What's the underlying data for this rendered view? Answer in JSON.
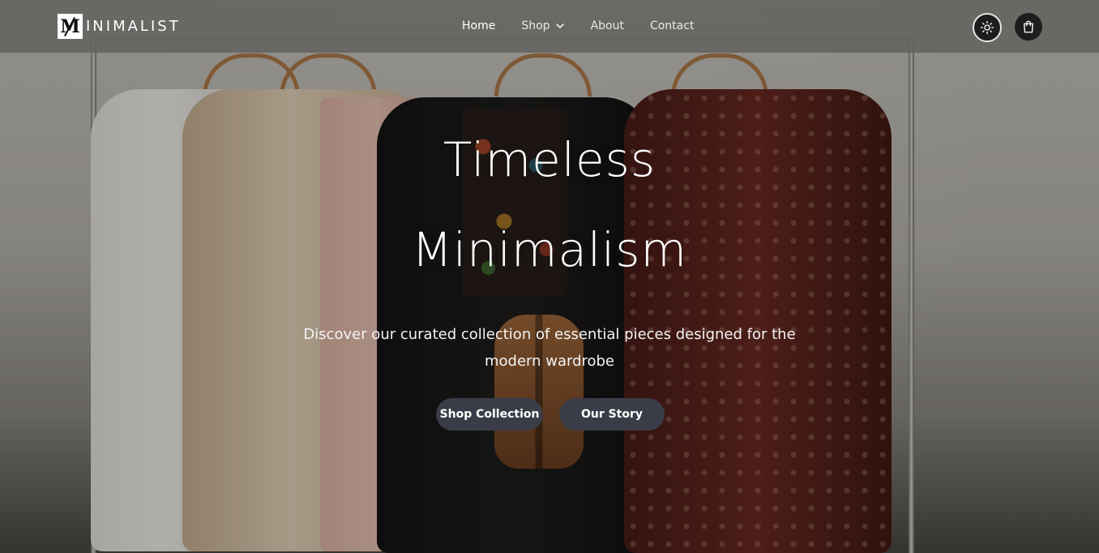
{
  "header": {
    "logo_mark": "M",
    "logo_text": "INIMALIST",
    "nav": [
      {
        "label": "Home",
        "active": true
      },
      {
        "label": "Shop",
        "has_dropdown": true
      },
      {
        "label": "About"
      },
      {
        "label": "Contact"
      }
    ],
    "icons": {
      "theme_toggle": "sun-icon",
      "cart": "shopping-bag-icon",
      "dropdown": "chevron-down-icon"
    }
  },
  "hero": {
    "title_line1": "Timeless",
    "title_line2": "Minimalism",
    "subtitle": "Discover our curated collection of essential pieces designed for the modern wardrobe",
    "primary_button": "Shop Collection",
    "secondary_button": "Our Story"
  },
  "colors": {
    "header_bg": "#646360",
    "button_bg": "#3a3d47",
    "icon_button_bg": "#1d1d1e",
    "text": "#ffffff"
  }
}
